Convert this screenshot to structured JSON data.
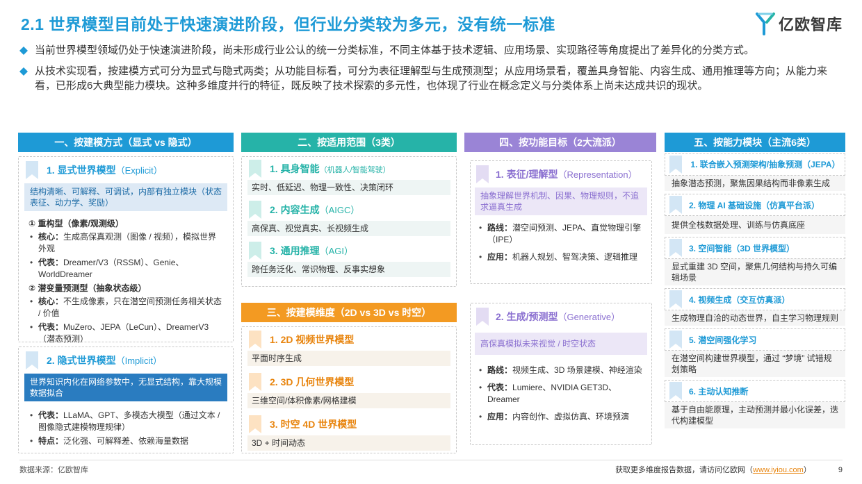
{
  "header": {
    "title": "2.1 世界模型目前处于快速演进阶段，但行业分类较为多元，没有统一标准",
    "logo_text": "亿欧智库"
  },
  "bullets": [
    "当前世界模型领域仍处于快速演进阶段，尚未形成行业公认的统一分类标准，不同主体基于技术逻辑、应用场景、实现路径等角度提出了差异化的分类方式。",
    "从技术实现看，按建模方式可分为显式与隐式两类；从功能目标看，可分为表征理解型与生成预测型；从应用场景看，覆盖具身智能、内容生成、通用推理等方向；从能力来看，已形成6大典型能力模块。这种多维度并行的特征，既反映了技术探索的多元性，也体现了行业在概念定义与分类体系上尚未达成共识的现状。"
  ],
  "col1": {
    "header": "一、按建模方式（显式 vs 隐式）",
    "explicit": {
      "title": "1. 显式世界模型",
      "title_en": "（Explicit）",
      "strip": "结构清晰、可解释、可调试，内部有独立模块（状态表征、动力学、奖励）",
      "sec1_title": "① 重构型（像素/观测级）",
      "sec1_items": [
        {
          "k": "核心：",
          "v": "生成高保真观测（图像 / 视频），模拟世界外观"
        },
        {
          "k": "代表：",
          "v": "Dreamer/V3（RSSM）、Genie、WorldDreamer"
        }
      ],
      "sec2_title": "② 潜变量预测型（抽象状态级）",
      "sec2_items": [
        {
          "k": "核心：",
          "v": "不生成像素，只在潜空间预测任务相关状态 / 价值"
        },
        {
          "k": "代表：",
          "v": "MuZero、JEPA（LeCun）、DreamerV3（潜态预测）"
        }
      ]
    },
    "implicit": {
      "title": "2. 隐式世界模型",
      "title_en": "（Implicit）",
      "strip": "世界知识内化在网络参数中，无显式结构，靠大规模数据拟合",
      "items": [
        {
          "k": "代表：",
          "v": "LLaMA、GPT、多模态大模型（通过文本 / 图像隐式建模物理规律）"
        },
        {
          "k": "特点：",
          "v": "泛化强、可解释差、依赖海量数据"
        }
      ]
    }
  },
  "col2": {
    "header": "二、按适用范围（3类）",
    "items": [
      {
        "title": "1. 具身智能",
        "title_en": "（机器人/智能驾驶）",
        "desc": "实时、低延迟、物理一致性、决策闭环"
      },
      {
        "title": "2. 内容生成",
        "title_en": "（AIGC）",
        "desc": "高保真、视觉真实、长视频生成"
      },
      {
        "title": "3. 通用推理",
        "title_en": "（AGI）",
        "desc": "跨任务泛化、常识物理、反事实想象"
      }
    ]
  },
  "col3": {
    "header": "三、按建模维度（2D vs 3D vs 时空）",
    "items": [
      {
        "title": "1. 2D 视频世界模型",
        "desc": "平面时序生成"
      },
      {
        "title": "2. 3D 几何世界模型",
        "desc": "三维空间/体积像素/网格建模"
      },
      {
        "title": "3. 时空 4D 世界模型",
        "desc": "3D + 时间动态"
      }
    ]
  },
  "col4": {
    "header": "四、按功能目标（2大流派）",
    "rep": {
      "title": "1. 表征/理解型",
      "title_en": "（Representation）",
      "strip": "抽象理解世界机制、因果、物理规则，不追求逼真生成",
      "items": [
        {
          "k": "路线：",
          "v": "潜空间预测、JEPA、直觉物理引擎（IPE）"
        },
        {
          "k": "应用：",
          "v": "机器人规划、智驾决策、逻辑推理"
        }
      ]
    },
    "gen": {
      "title": "2. 生成/预测型",
      "title_en": "（Generative）",
      "strip": "高保真模拟未来视觉 / 时空状态",
      "items": [
        {
          "k": "路线：",
          "v": "视频生成、3D 场景建模、神经渲染"
        },
        {
          "k": "代表：",
          "v": "Lumiere、NVIDIA GET3D、Dreamer"
        },
        {
          "k": "应用：",
          "v": "内容创作、虚拟仿真、环境预演"
        }
      ]
    }
  },
  "col5": {
    "header": "五、按能力模块（主流6类）",
    "items": [
      {
        "title": "1. 联合嵌入预测架构/抽象预测（JEPA）",
        "desc": "抽象潜态预测，聚焦因果结构而非像素生成"
      },
      {
        "title": "2. 物理 AI 基础设施（仿真平台派）",
        "desc": "提供全栈数据处理、训练与仿真底座"
      },
      {
        "title": "3. 空间智能（3D 世界模型）",
        "desc": "显式重建 3D 空间，聚焦几何结构与持久可编辑场景"
      },
      {
        "title": "4. 视频生成（交互仿真派）",
        "desc": "生成物理自洽的动态世界，自主学习物理规则"
      },
      {
        "title": "5. 潜空间强化学习",
        "desc": "在潜空间构建世界模型，通过 “梦境” 试错规划策略"
      },
      {
        "title": "6. 主动认知推断",
        "desc": "基于自由能原理，主动预测并最小化误差，迭代构建模型"
      }
    ]
  },
  "footer": {
    "source": "数据来源：亿欧智库",
    "more": "获取更多维度报告数据，请访问亿欧网（",
    "link": "www.iyiou.com",
    "close": "）",
    "page": "9"
  },
  "colors": {
    "blue": "#1e9ad6",
    "teal": "#26b3a8",
    "orange": "#f39a22",
    "purple": "#9a84d6",
    "navy": "#2a7cc0"
  }
}
